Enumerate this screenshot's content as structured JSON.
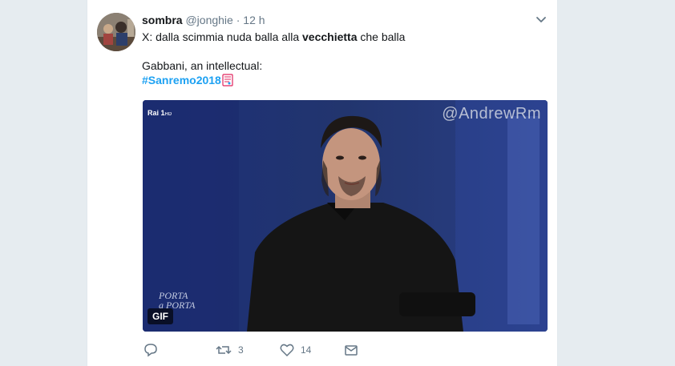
{
  "tweet": {
    "display_name": "sombra",
    "handle": "@jonghie",
    "separator": "·",
    "timestamp": "12 h",
    "text_prefix": "X: dalla scimmia nuda balla alla ",
    "text_bold": "vecchietta",
    "text_suffix": " che balla",
    "line2": "Gabbani, an intellectual:",
    "hashtag": "#Sanremo2018",
    "hashtag_emoji": "music-sheet-icon",
    "media": {
      "watermark": "@AndrewRm",
      "channel": "Rai",
      "channel_num": "1",
      "channel_hd": "HD",
      "logo_line1": "PORTA",
      "logo_line2": "a PORTA",
      "badge": "GIF"
    },
    "actions": {
      "reply_count": "",
      "retweet_count": "3",
      "like_count": "14"
    }
  },
  "colors": {
    "background": "#e6ecf0",
    "link": "#1da1f2",
    "muted": "#657786"
  }
}
